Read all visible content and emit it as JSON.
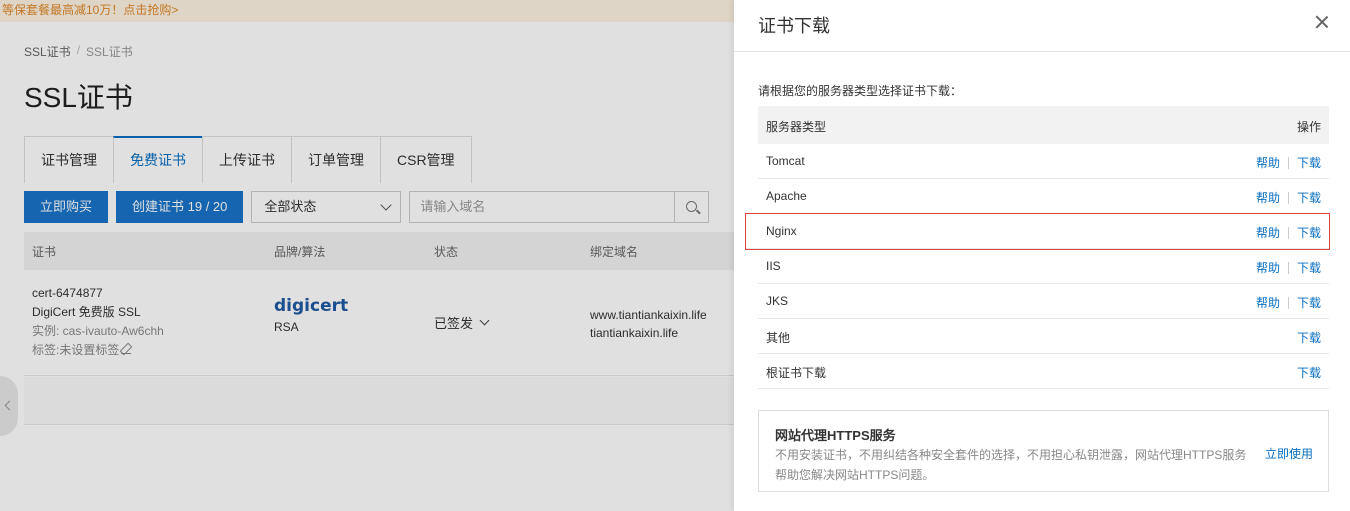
{
  "promo_banner": "等保套餐最高减10万！点击抢购>",
  "breadcrumb": [
    "SSL证书",
    "SSL证书"
  ],
  "page_title": "SSL证书",
  "tabs": [
    "证书管理",
    "免费证书",
    "上传证书",
    "订单管理",
    "CSR管理"
  ],
  "toolbar": {
    "buy_label": "立即购买",
    "create_label": "创建证书 19 / 20",
    "status_select": "全部状态",
    "search_placeholder": "请输入域名"
  },
  "cert_table": {
    "columns": [
      "证书",
      "品牌/算法",
      "状态",
      "绑定域名"
    ],
    "row": {
      "id": "cert-6474877",
      "name": "DigiCert 免费版 SSL",
      "instance": "实例: cas-ivauto-Aw6chh",
      "tag": "标签:未设置标签",
      "brand_logo": "digicert",
      "algorithm": "RSA",
      "status": "已签发",
      "domains": [
        "www.tiantiankaixin.life",
        "tiantiankaixin.life"
      ]
    }
  },
  "drawer": {
    "title": "证书下载",
    "description": "请根据您的服务器类型选择证书下载：",
    "table_headers": {
      "server_type": "服务器类型",
      "action": "操作"
    },
    "rows": [
      {
        "name": "Tomcat",
        "help": "帮助",
        "download": "下载"
      },
      {
        "name": "Apache",
        "help": "帮助",
        "download": "下载"
      },
      {
        "name": "Nginx",
        "help": "帮助",
        "download": "下载"
      },
      {
        "name": "IIS",
        "help": "帮助",
        "download": "下载"
      },
      {
        "name": "JKS",
        "help": "帮助",
        "download": "下载"
      },
      {
        "name": "其他",
        "download": "下载"
      },
      {
        "name": "根证书下载",
        "download": "下载"
      }
    ],
    "highlighted_row": "Nginx",
    "promo": {
      "title": "网站代理HTTPS服务",
      "description": "不用安装证书，不用纠结各种安全套件的选择，不用担心私钥泄露，网站代理HTTPS服务帮助您解决网站HTTPS问题。",
      "link": "立即使用"
    }
  },
  "colors": {
    "accent": "#0a6fc2",
    "primary_button": "#1a73c9",
    "highlight_border": "#e0423b",
    "promo_text": "#e0892b"
  }
}
